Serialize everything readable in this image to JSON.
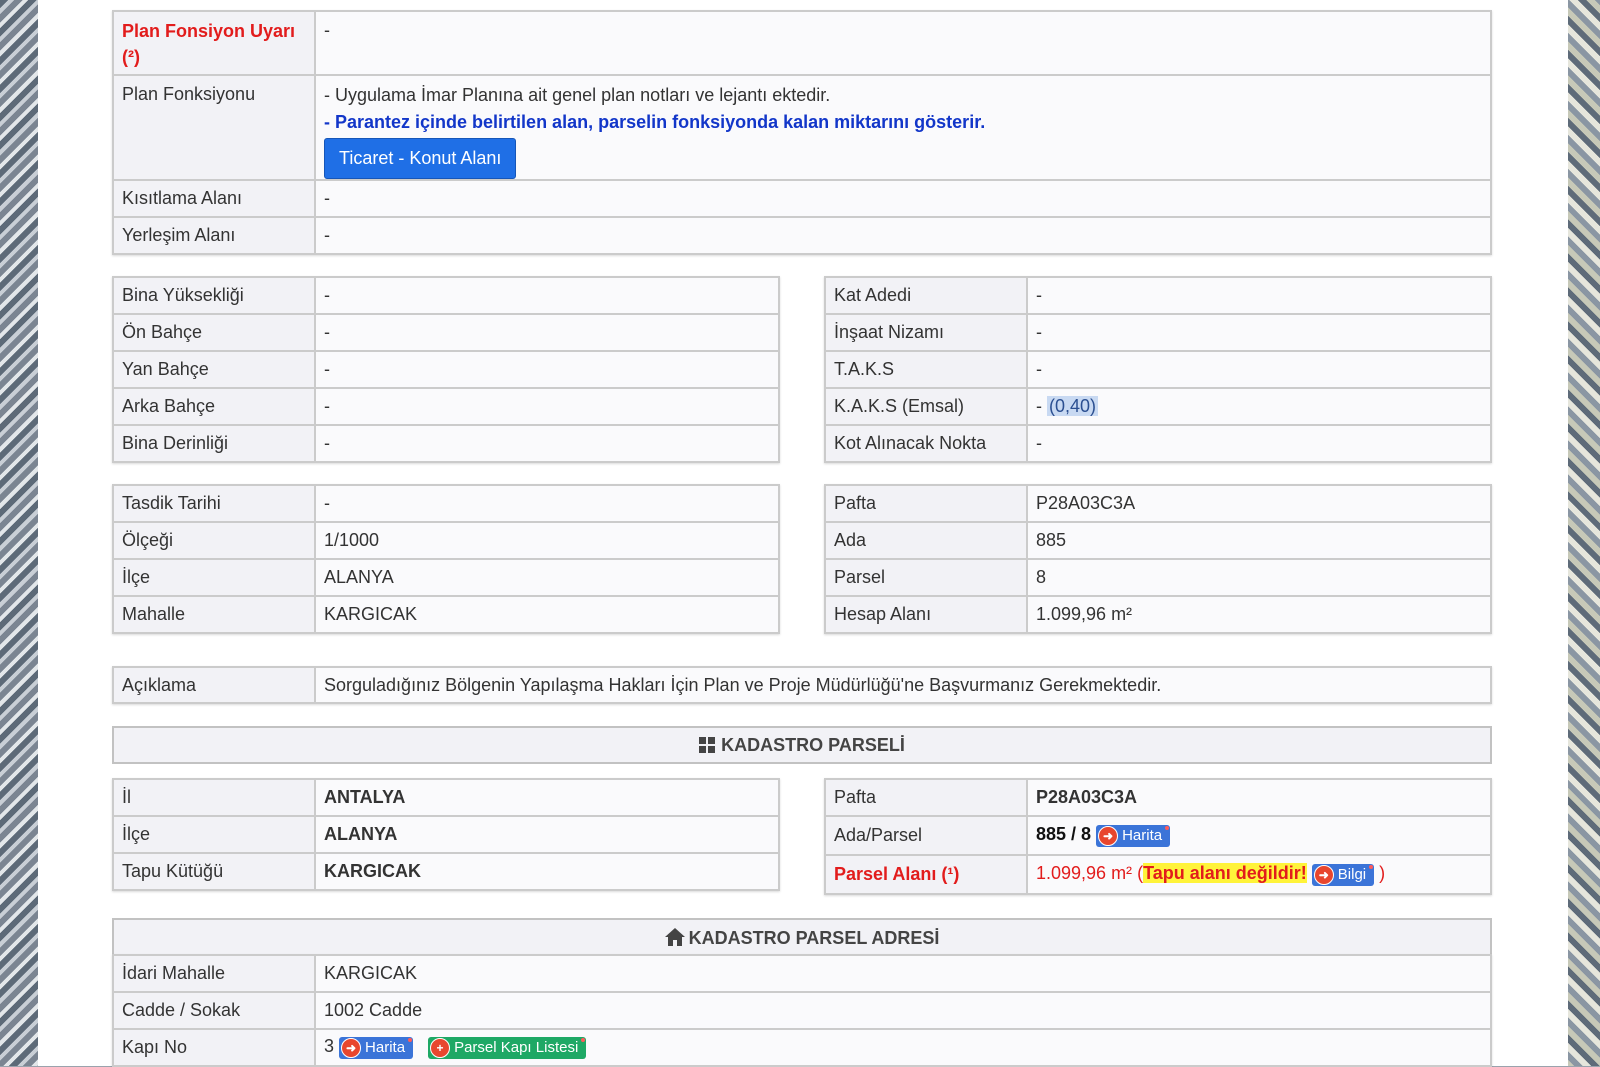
{
  "plan": {
    "warning_label": "Plan Fonsiyon Uyarı",
    "warning_ref": "(²)",
    "warning_value": "-",
    "function_label": "Plan Fonksiyonu",
    "function_note1": "- Uygulama İmar Planına ait genel plan notları ve lejantı ektedir.",
    "function_note2": "- Parantez içinde belirtilen alan, parselin fonksiyonda kalan miktarını gösterir.",
    "function_button": "Ticaret - Konut Alanı",
    "restriction_label": "Kısıtlama Alanı",
    "restriction_value": "-",
    "settlement_label": "Yerleşim Alanı",
    "settlement_value": "-"
  },
  "building_left": [
    {
      "label": "Bina Yüksekliği",
      "value": "-"
    },
    {
      "label": "Ön Bahçe",
      "value": "-"
    },
    {
      "label": "Yan Bahçe",
      "value": "-"
    },
    {
      "label": "Arka Bahçe",
      "value": "-"
    },
    {
      "label": "Bina Derinliği",
      "value": "-"
    }
  ],
  "building_right": {
    "kat_label": "Kat Adedi",
    "kat_value": "-",
    "nizam_label": "İnşaat Nizamı",
    "nizam_value": "-",
    "taks_label": "T.A.K.S",
    "taks_value": "-",
    "kaks_label": "K.A.K.S (Emsal)",
    "kaks_dash": "-",
    "kaks_value": "(0,40)",
    "kot_label": "Kot Alınacak Nokta",
    "kot_value": "-"
  },
  "approval_left": [
    {
      "label": "Tasdik Tarihi",
      "value": "-"
    },
    {
      "label": "Ölçeği",
      "value": "1/1000"
    },
    {
      "label": "İlçe",
      "value": "ALANYA"
    },
    {
      "label": "Mahalle",
      "value": "KARGICAK"
    }
  ],
  "approval_right": [
    {
      "label": "Pafta",
      "value": "P28A03C3A"
    },
    {
      "label": "Ada",
      "value": "885"
    },
    {
      "label": "Parsel",
      "value": "8"
    },
    {
      "label": "Hesap Alanı",
      "value": "1.099,96 m²"
    }
  ],
  "description": {
    "label": "Açıklama",
    "value": "Sorguladığınız Bölgenin Yapılaşma Hakları İçin Plan ve Proje Müdürlüğü'ne Başvurmanız Gerekmektedir."
  },
  "cadastre": {
    "title": "KADASTRO PARSELİ",
    "il_label": "İl",
    "il_value": "ANTALYA",
    "ilce_label": "İlçe",
    "ilce_value": "ALANYA",
    "tapu_label": "Tapu Kütüğü",
    "tapu_value": "KARGICAK",
    "pafta_label": "Pafta",
    "pafta_value": "P28A03C3A",
    "adaparsel_label": "Ada/Parsel",
    "adaparsel_value": "885 / 8",
    "harita_button": "Harita",
    "area_label": "Parsel Alanı",
    "area_ref": "(¹)",
    "area_value": "1.099,96 m²",
    "area_open": "(",
    "area_warning": "Tapu alanı değildir!",
    "bilgi_button": "Bilgi",
    "area_close": ")"
  },
  "address": {
    "title": "KADASTRO PARSEL ADRESİ",
    "mahalle_label": "İdari Mahalle",
    "mahalle_value": "KARGICAK",
    "cadde_label": "Cadde / Sokak",
    "cadde_value": "1002 Cadde",
    "kapi_label": "Kapı No",
    "kapi_value": "3",
    "harita_button": "Harita",
    "kapi_list_button": "Parsel Kapı Listesi"
  },
  "colors": {
    "warning_red": "#e21c1c",
    "note_blue": "#1236c9",
    "primary_button": "#1f6fe6",
    "highlight_yellow": "#fff33a",
    "green_button": "#1ea865"
  }
}
